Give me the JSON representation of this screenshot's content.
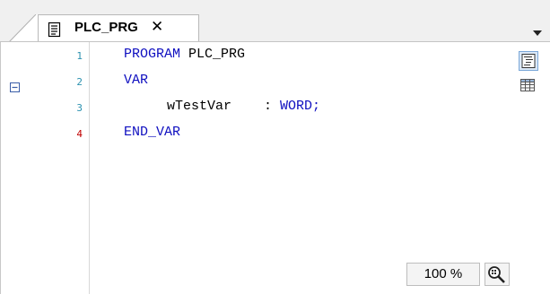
{
  "tab": {
    "title": "PLC_PRG",
    "close_glyph": "✕",
    "icon": "document-icon"
  },
  "editor": {
    "lines": [
      {
        "number": "1",
        "number_color": "#2b91af"
      },
      {
        "number": "2",
        "number_color": "#2b91af"
      },
      {
        "number": "3",
        "number_color": "#2b91af"
      },
      {
        "number": "4",
        "number_color": "#c00000"
      }
    ],
    "code": {
      "line1_kw": "PROGRAM",
      "line1_name": " PLC_PRG",
      "line2_kw": "VAR",
      "line3_var": "wTestVar",
      "line3_colon": "    : ",
      "line3_type": "WORD;",
      "line4_kw": "END_VAR"
    },
    "fold_icon": "collapse-minus-icon"
  },
  "toolbar": {
    "buttons": [
      {
        "name": "textual-view-icon",
        "active": true
      },
      {
        "name": "tabular-view-icon",
        "active": false
      }
    ]
  },
  "status": {
    "zoom": "100 %",
    "zoom_icon": "magnifier-icon"
  },
  "colors": {
    "keyword": "#1010c0",
    "line_number": "#2b91af",
    "line_number_modified": "#c00000"
  }
}
